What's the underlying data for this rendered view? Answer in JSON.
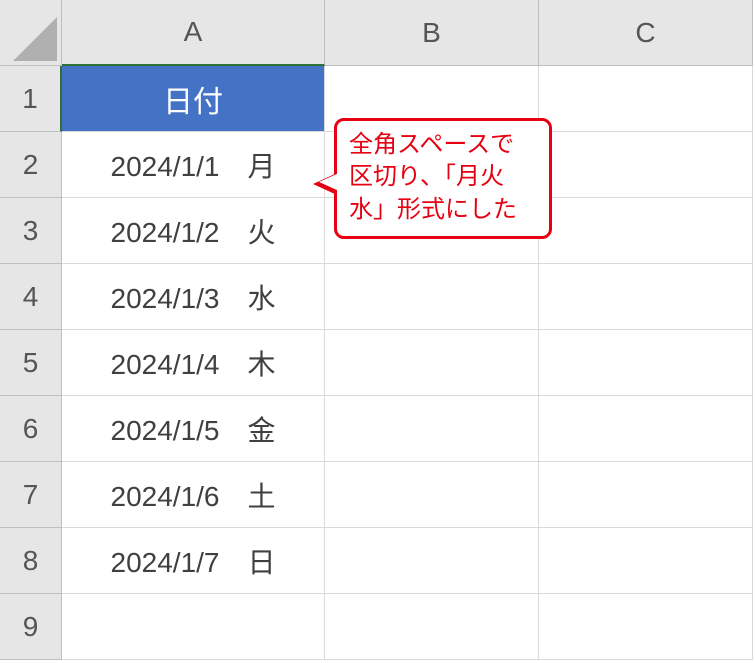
{
  "columns": [
    "A",
    "B",
    "C"
  ],
  "rows": [
    "1",
    "2",
    "3",
    "4",
    "5",
    "6",
    "7",
    "8",
    "9"
  ],
  "headerCell": "日付",
  "data": [
    "2024/1/1　月",
    "2024/1/2　火",
    "2024/1/3　水",
    "2024/1/4　木",
    "2024/1/5　金",
    "2024/1/6　土",
    "2024/1/7　日"
  ],
  "callout": "全角スペースで区切り、「月火水」形式にした",
  "chart_data": {
    "type": "table",
    "title": "日付",
    "columns": [
      "日付"
    ],
    "rows": [
      [
        "2024/1/1　月"
      ],
      [
        "2024/1/2　火"
      ],
      [
        "2024/1/3　水"
      ],
      [
        "2024/1/4　木"
      ],
      [
        "2024/1/5　金"
      ],
      [
        "2024/1/6　土"
      ],
      [
        "2024/1/7　日"
      ]
    ]
  }
}
